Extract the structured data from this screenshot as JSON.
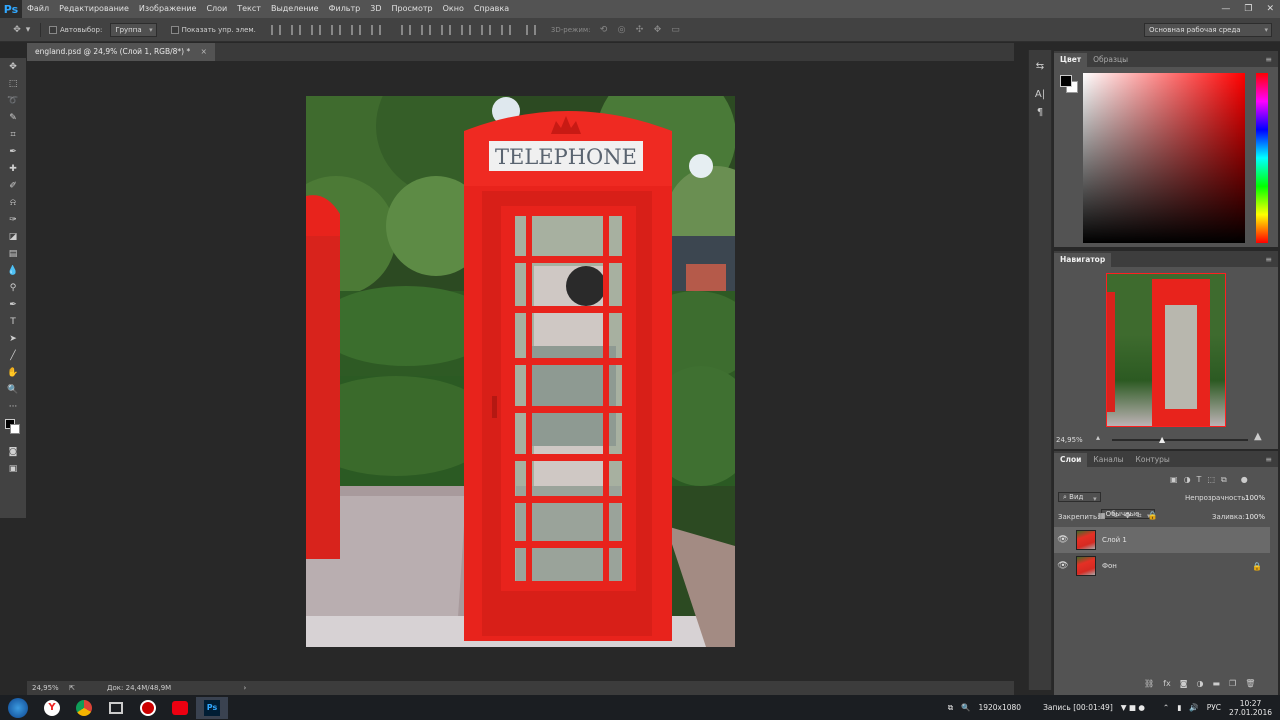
{
  "app": {
    "logo": "Ps"
  },
  "menu": [
    "Файл",
    "Редактирование",
    "Изображение",
    "Слои",
    "Текст",
    "Выделение",
    "Фильтр",
    "3D",
    "Просмотр",
    "Окно",
    "Справка"
  ],
  "options_bar": {
    "autoselect_label": "Автовыбор:",
    "autoselect_value": "Группа",
    "show_controls_label": "Показать упр. элем.",
    "mode_3d_label": "3D-режим:",
    "workspace": "Основная рабочая среда"
  },
  "document": {
    "tab_title": "england.psd @ 24,9% (Слой 1, RGB/8*) *",
    "close_glyph": "×",
    "phone_sign": "TELEPHONE",
    "status_zoom": "24,95%",
    "status_doc": "Док: 24,4М/48,9М"
  },
  "color_panel": {
    "tabs": [
      "Цвет",
      "Образцы"
    ]
  },
  "navigator_panel": {
    "tab": "Навигатор",
    "zoom": "24,95%"
  },
  "layers_panel": {
    "tabs": [
      "Слои",
      "Каналы",
      "Контуры"
    ],
    "filter_label": "Вид",
    "blend_mode": "Обычные",
    "opacity_label": "Непрозрачность:",
    "opacity_value": "100%",
    "lock_label": "Закрепить:",
    "fill_label": "Заливка:",
    "fill_value": "100%",
    "layers": [
      {
        "name": "Слой 1",
        "selected": true
      },
      {
        "name": "Фон",
        "locked": true
      }
    ]
  },
  "taskbar": {
    "resolution": "1920x1080",
    "recording": "Запись [00:01:49]",
    "language": "РУС",
    "time": "10:27",
    "date": "27.01.2016"
  },
  "colors": {
    "phone_red": "#e8231c",
    "ps_blue": "#31a8ff",
    "panel_bg": "#535353",
    "canvas_bg": "#282828"
  }
}
